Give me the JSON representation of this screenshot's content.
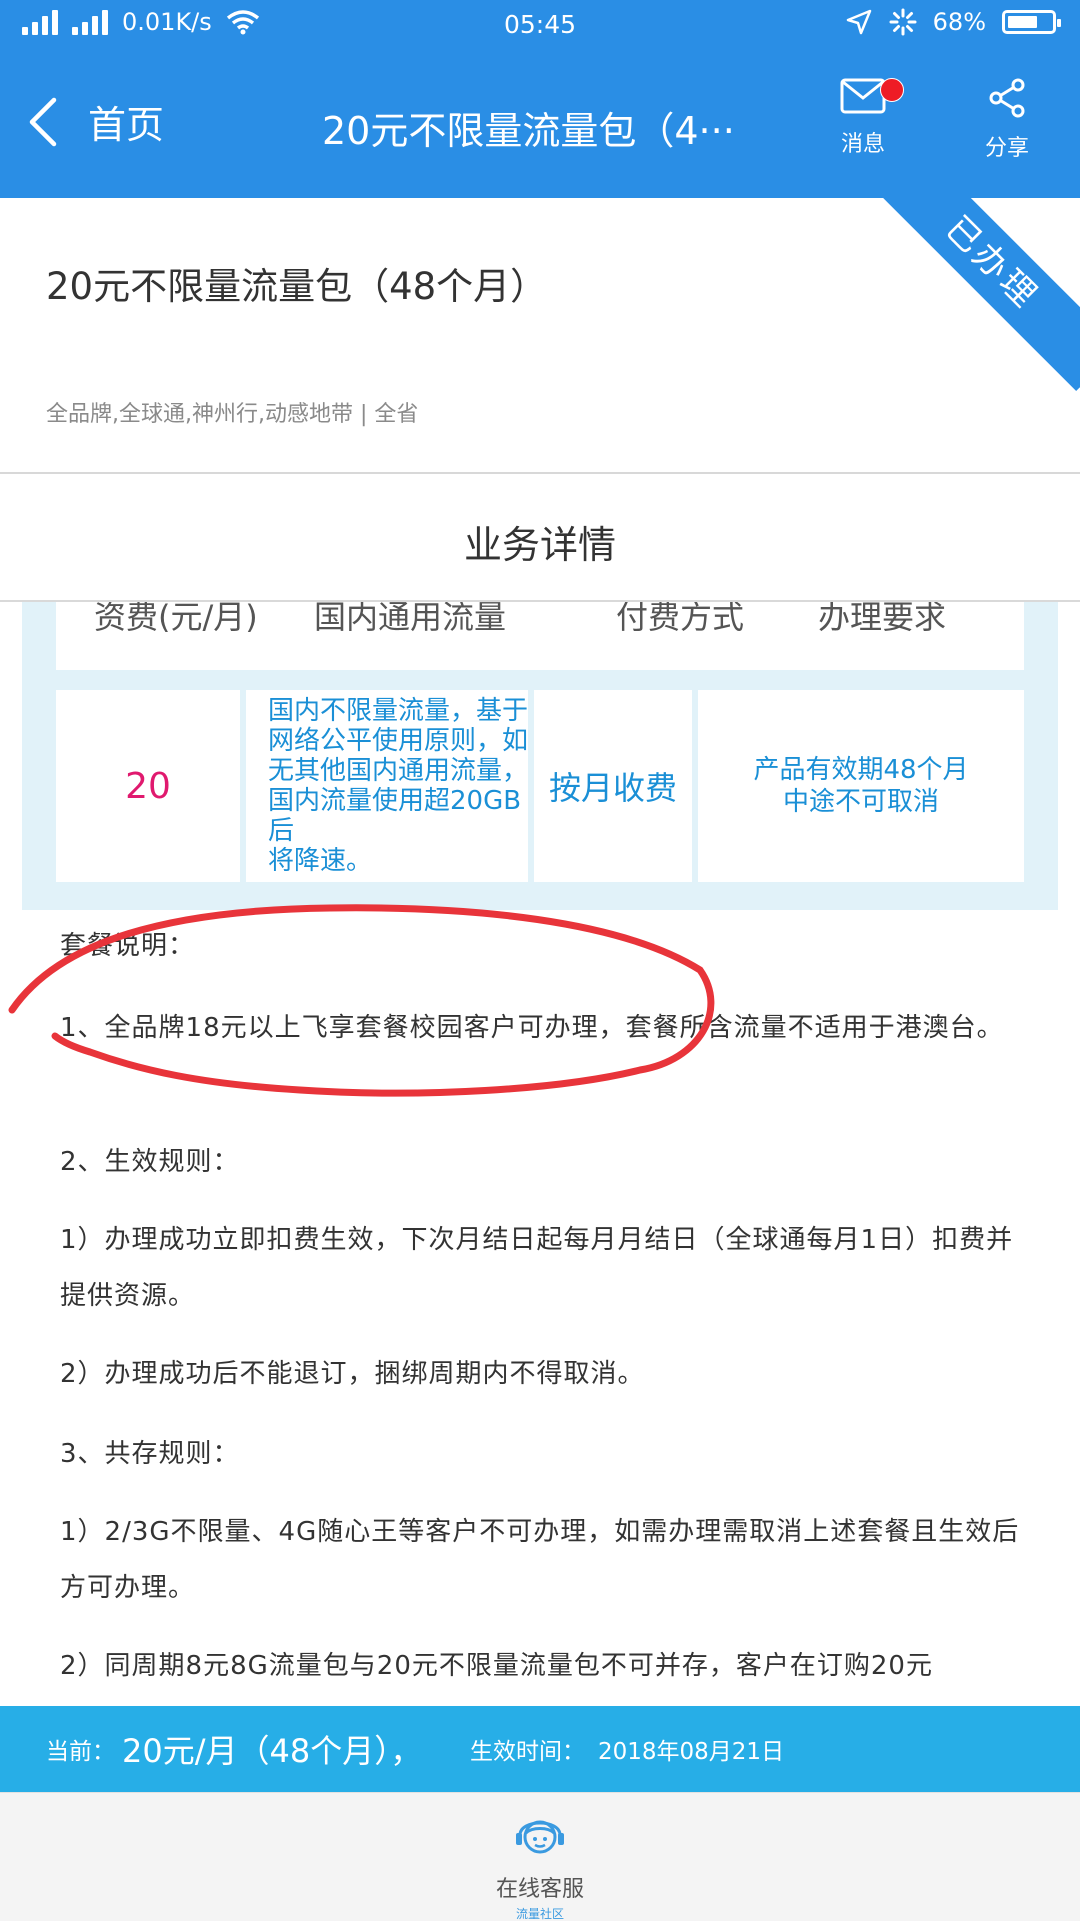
{
  "status_bar": {
    "speed": "0.01K/s",
    "time": "05:45",
    "battery": "68%",
    "battery_level": 0.68
  },
  "nav": {
    "back_label": "首页",
    "title": "20元不限量流量包（4···",
    "messages_label": "消息",
    "share_label": "分享"
  },
  "product": {
    "title": "20元不限量流量包（48个月）",
    "meta": "全品牌,全球通,神州行,动感地带  |  全省",
    "ribbon": "已办理"
  },
  "section": {
    "title": "业务详情"
  },
  "table": {
    "headers": [
      "资费(元/月)",
      "国内通用流量",
      "付费方式",
      "办理要求"
    ],
    "row": {
      "price": "20",
      "traffic": [
        "国内不限量流量，基于",
        "网络公平使用原则，如",
        "无其他国内通用流量，",
        "国内流量使用超20GB后",
        "将降速。"
      ],
      "payment": "按月收费",
      "requirement": [
        "产品有效期48个月",
        "中途不可取消"
      ]
    }
  },
  "description": {
    "heading": "套餐说明：",
    "item1": "1、全品牌18元以上飞享套餐校园客户可办理，套餐所含流量不适用于港澳台。",
    "item2_title": "2、生效规则：",
    "item2_1": "1）办理成功立即扣费生效，下次月结日起每月月结日（全球通每月1日）扣费并提供资源。",
    "item2_2": "2）办理成功后不能退订，捆绑周期内不得取消。",
    "item3_title": "3、共存规则：",
    "item3_1": "1）2/3G不限量、4G随心王等客户不可办理，如需办理需取消上述套餐且生效后方可办理。",
    "item3_2": "2）同周期8元8G流量包与20元不限量流量包不可并存，客户在订购20元"
  },
  "current": {
    "label": "当前：",
    "plan": "20元/月（48个月），",
    "effective_label": "生效时间：",
    "effective_date": "2018年08月21日"
  },
  "footer": {
    "service_label": "在线客服",
    "service_sub": "流量社区"
  },
  "colors": {
    "primary": "#2a8ee5",
    "current_bar": "#27aee7",
    "price": "#e0196e",
    "cell_text": "#1a8fd6",
    "scribble": "#e8343a"
  }
}
